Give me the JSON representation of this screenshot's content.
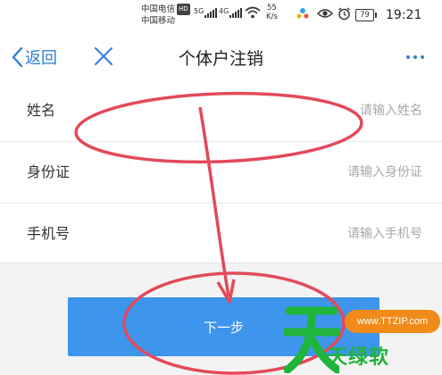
{
  "status_bar": {
    "carrier_1": "中国电信",
    "carrier_1_badge": "HD",
    "carrier_2": "中国移动",
    "network_1": "5G",
    "network_2": "4G",
    "speed_value": "55",
    "speed_unit": "K/s",
    "battery": "79",
    "time": "19:21"
  },
  "nav": {
    "back_label": "返回",
    "title": "个体户注销"
  },
  "form": {
    "fields": [
      {
        "label": "姓名",
        "placeholder": "请输入姓名"
      },
      {
        "label": "身份证",
        "placeholder": "请输入身份证"
      },
      {
        "label": "手机号",
        "placeholder": "请输入手机号"
      }
    ]
  },
  "next_button": "下一步",
  "watermark": {
    "url": "www.TTZIP.com",
    "brand": "天绿软"
  },
  "colors": {
    "accent": "#2f7fd4",
    "button": "#3e95ec",
    "annotation": "#e24a5a",
    "watermark_green": "#1fb43a",
    "watermark_orange": "#f08b1a"
  }
}
